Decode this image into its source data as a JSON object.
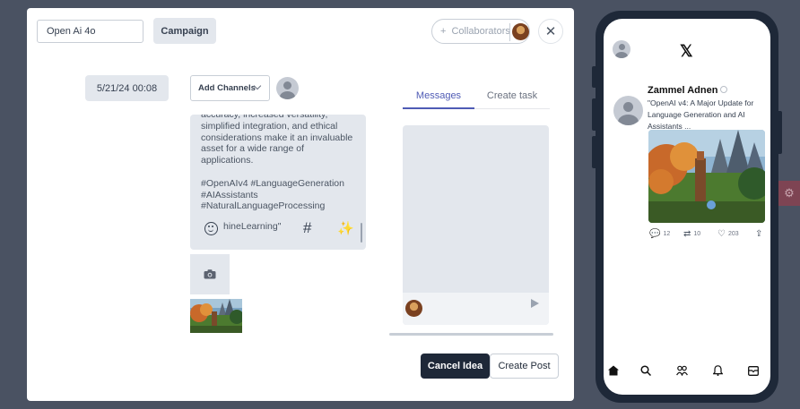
{
  "modal": {
    "title_input_value": "Open Ai 4o",
    "campaign_label": "Campaign",
    "collaborators_plus": "+",
    "collaborators_label": "Collaborators",
    "close_symbol": "✕",
    "date_label": "5/21/24 00:08",
    "add_channels_label": "Add Channels"
  },
  "editor": {
    "content": "accuracy, increased versatility, simplified integration, and ethical considerations make it an invaluable asset for a wide range of applications.\n\n#OpenAIv4 #LanguageGeneration #AIAssistants #NaturalLanguageProcessing",
    "line_under_toolbar": "hineLearning\"",
    "hash_symbol": "#",
    "sparkle_symbol": "✨"
  },
  "tabs": [
    {
      "label": "Messages",
      "active": true
    },
    {
      "label": "Create task",
      "active": false
    }
  ],
  "actions": {
    "cancel_label": "Cancel Idea",
    "create_label": "Create Post"
  },
  "preview": {
    "platform_logo": "𝕏",
    "author_name": "Zammel Adnen",
    "tweet_text": "\"OpenAI v4: A Major Update for Language Generation and AI Assistants ...",
    "stats": {
      "replies": "12",
      "retweets": "10",
      "likes": "203"
    },
    "nav_icons": [
      "home-icon",
      "search-icon",
      "community-icon",
      "bell-icon",
      "mail-icon"
    ]
  },
  "colors": {
    "background": "#4a5262",
    "accent": "#4f5bb5",
    "dark_button": "#1e2838"
  }
}
